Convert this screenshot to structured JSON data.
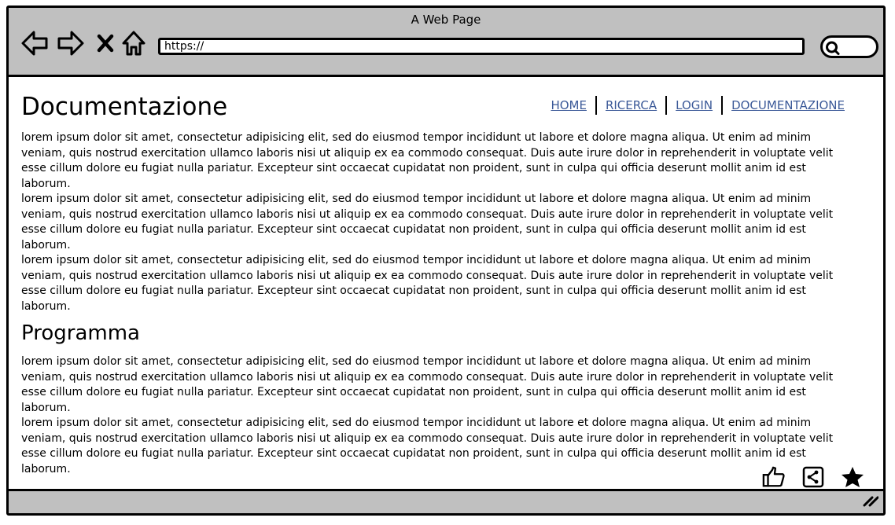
{
  "window": {
    "title": "A Web Page"
  },
  "toolbar": {
    "url": "https://",
    "icons": [
      "back-arrow-icon",
      "forward-arrow-icon",
      "close-x-icon",
      "home-icon",
      "search-icon"
    ]
  },
  "page": {
    "title": "Documentazione",
    "nav": [
      "HOME",
      "RICERCA",
      "LOGIN",
      "DOCUMENTAZIONE"
    ],
    "section_title": "Programma",
    "paragraphs_1": [
      "lorem ipsum dolor sit amet, consectetur adipisicing elit, sed do eiusmod tempor incididunt ut labore et dolore magna aliqua. Ut enim ad minim veniam, quis nostrud exercitation ullamco laboris nisi ut aliquip ex ea commodo consequat. Duis aute irure dolor in reprehenderit in voluptate velit esse cillum dolore eu fugiat nulla pariatur. Excepteur sint occaecat cupidatat non proident, sunt in culpa qui officia deserunt mollit anim id est laborum.",
      "lorem ipsum dolor sit amet, consectetur adipisicing elit, sed do eiusmod tempor incididunt ut labore et dolore magna aliqua. Ut enim ad minim veniam, quis nostrud exercitation ullamco laboris nisi ut aliquip ex ea commodo consequat. Duis aute irure dolor in reprehenderit in voluptate velit esse cillum dolore eu fugiat nulla pariatur. Excepteur sint occaecat cupidatat non proident, sunt in culpa qui officia deserunt mollit anim id est laborum.",
      "lorem ipsum dolor sit amet, consectetur adipisicing elit, sed do eiusmod tempor incididunt ut labore et dolore magna aliqua. Ut enim ad minim veniam, quis nostrud exercitation ullamco laboris nisi ut aliquip ex ea commodo consequat. Duis aute irure dolor in reprehenderit in voluptate velit esse cillum dolore eu fugiat nulla pariatur. Excepteur sint occaecat cupidatat non proident, sunt in culpa qui officia deserunt mollit anim id est laborum."
    ],
    "paragraphs_2": [
      "lorem ipsum dolor sit amet, consectetur adipisicing elit, sed do eiusmod tempor incididunt ut labore et dolore magna aliqua. Ut enim ad minim veniam, quis nostrud exercitation ullamco laboris nisi ut aliquip ex ea commodo consequat. Duis aute irure dolor in reprehenderit in voluptate velit esse cillum dolore eu fugiat nulla pariatur. Excepteur sint occaecat cupidatat non proident, sunt in culpa qui officia deserunt mollit anim id est laborum.",
      "lorem ipsum dolor sit amet, consectetur adipisicing elit, sed do eiusmod tempor incididunt ut labore et dolore magna aliqua. Ut enim ad minim veniam, quis nostrud exercitation ullamco laboris nisi ut aliquip ex ea commodo consequat. Duis aute irure dolor in reprehenderit in voluptate velit esse cillum dolore eu fugiat nulla pariatur. Excepteur sint occaecat cupidatat non proident, sunt in culpa qui officia deserunt mollit anim id est laborum."
    ]
  },
  "actions": [
    "thumbs-up-icon",
    "share-icon",
    "star-icon"
  ],
  "colors": {
    "chrome": "#c0c0c0",
    "link": "#3b5998",
    "border": "#000000"
  }
}
